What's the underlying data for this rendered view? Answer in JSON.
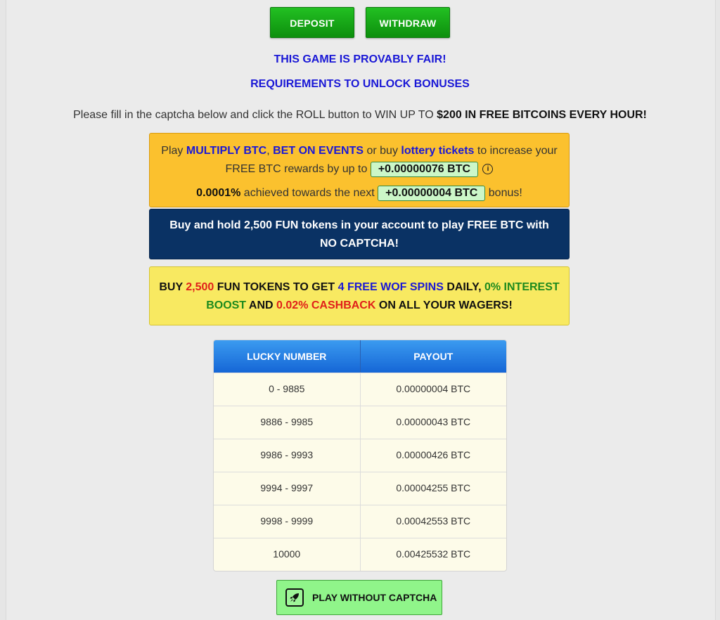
{
  "top_buttons": {
    "deposit": "DEPOSIT",
    "withdraw": "WITHDRAW"
  },
  "links": {
    "provably_fair": "THIS GAME IS PROVABLY FAIR!",
    "requirements": "REQUIREMENTS TO UNLOCK BONUSES"
  },
  "instruction": {
    "text": "Please fill in the captcha below and click the ROLL button to WIN UP TO ",
    "highlight": "$200 IN FREE BITCOINS EVERY HOUR!"
  },
  "bonus_box": {
    "play": "Play ",
    "multiply": "MULTIPLY BTC",
    "comma": ", ",
    "bet_events": "BET ON EVENTS",
    "or_buy": " or buy ",
    "lottery": "lottery tickets",
    "increase": " to increase your",
    "free_btc": "FREE BTC rewards by up to ",
    "max_bonus": "+0.00000076 BTC",
    "info_glyph": "i",
    "achieved_pct": "0.0001%",
    "achieved_text": " achieved towards the next ",
    "next_bonus": "+0.00000004 BTC",
    "bonus_word": " bonus!"
  },
  "fun_box": {
    "line1": "Buy and hold 2,500 FUN tokens in your account to play FREE BTC with",
    "line2": "NO CAPTCHA!"
  },
  "promo_box": {
    "buy": "BUY ",
    "amount": "2,500",
    "fun_tokens": " FUN TOKENS TO GET ",
    "wof": "4 FREE WOF SPINS",
    "daily": " DAILY, ",
    "interest": "0% INTEREST",
    "boost": "BOOST",
    "and": " AND ",
    "cashback": "0.02% CASHBACK",
    "wagers": " ON ALL YOUR WAGERS!"
  },
  "payout_table": {
    "headers": [
      "LUCKY NUMBER",
      "PAYOUT"
    ],
    "rows": [
      [
        "0 - 9885",
        "0.00000004 BTC"
      ],
      [
        "9886 - 9985",
        "0.00000043 BTC"
      ],
      [
        "9986 - 9993",
        "0.00000426 BTC"
      ],
      [
        "9994 - 9997",
        "0.00004255 BTC"
      ],
      [
        "9998 - 9999",
        "0.00042553 BTC"
      ],
      [
        "10000",
        "0.00425532 BTC"
      ]
    ]
  },
  "play_button": {
    "label": "PLAY WITHOUT CAPTCHA",
    "icon": "rocket-icon"
  },
  "colors": {
    "link_blue": "#1a18d6",
    "green_button": "#0d8f0d",
    "orange_box": "#fbc12e",
    "navy_box": "#0a3264",
    "yellow_box": "#f8e961",
    "table_header": "#1566d6",
    "play_button": "#90f58a"
  }
}
